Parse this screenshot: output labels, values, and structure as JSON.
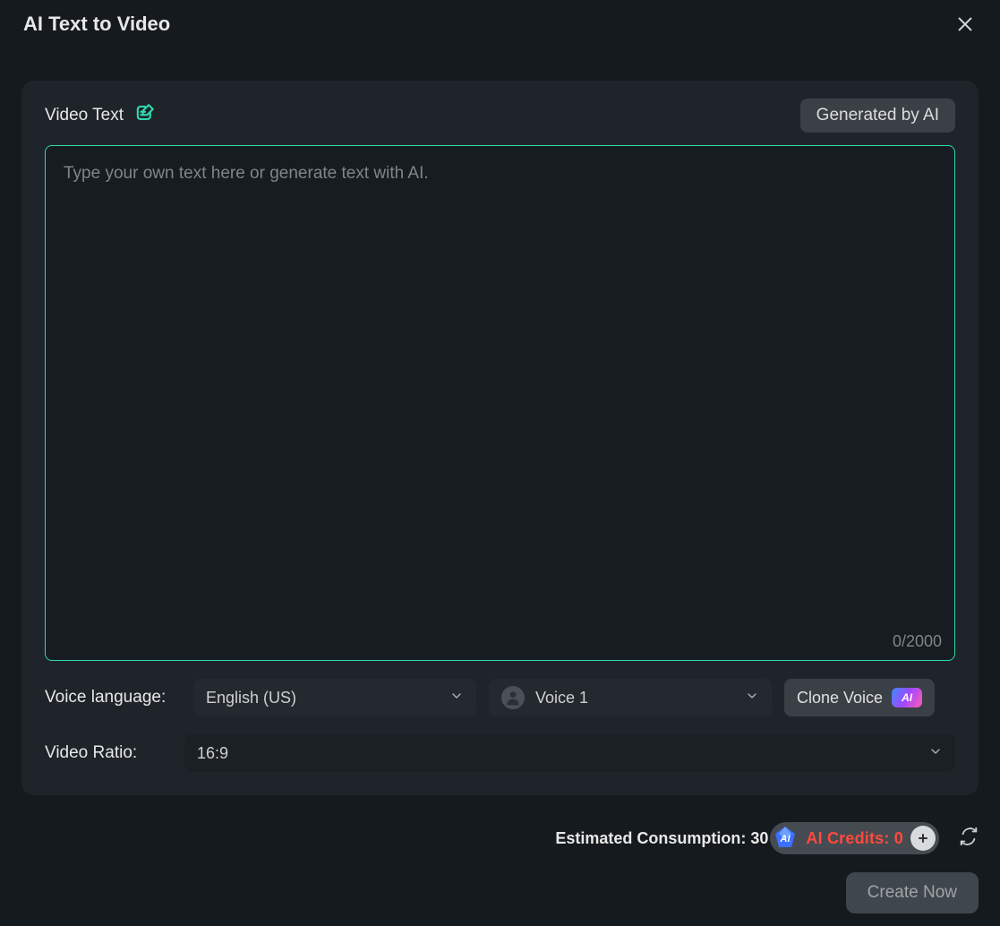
{
  "modal": {
    "title": "AI Text to Video"
  },
  "panel": {
    "section_label": "Video Text",
    "generate_ai_label": "Generated by AI",
    "textarea_placeholder": "Type your own text here or generate text with AI.",
    "textarea_value": "",
    "counter": "0/2000"
  },
  "voice": {
    "language_label": "Voice language:",
    "language_value": "English (US)",
    "voice_value": "Voice 1",
    "clone_label": "Clone Voice",
    "ai_badge": "AI"
  },
  "ratio": {
    "label": "Video Ratio:",
    "value": "16:9"
  },
  "footer": {
    "estimated_label": "Estimated Consumption: 30",
    "ai_gem": "AI",
    "credits_label": "AI Credits: 0",
    "create_label": "Create Now"
  }
}
